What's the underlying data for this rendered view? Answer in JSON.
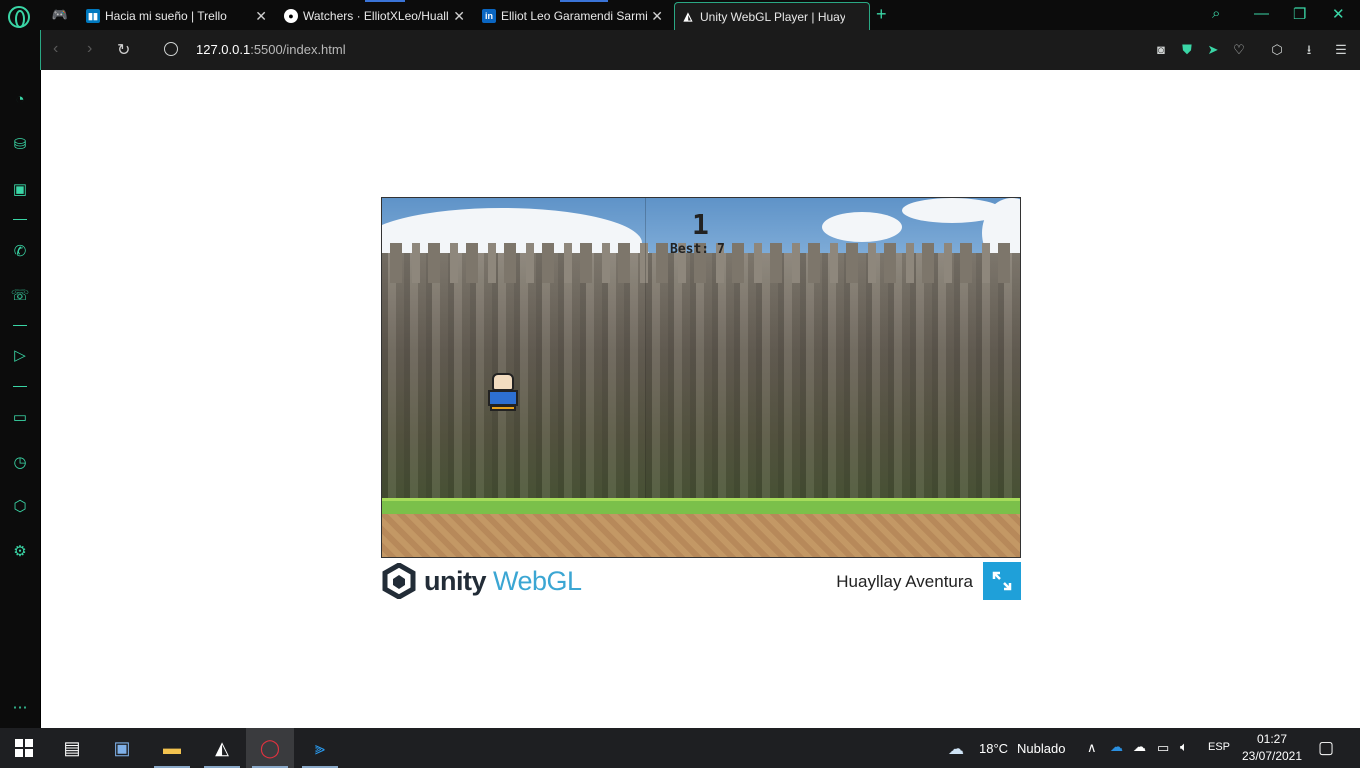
{
  "browser": {
    "tabs": [
      {
        "title": "Hacia mi sueño | Trello",
        "favicon": "trello-icon",
        "color": "#0079bf"
      },
      {
        "title": "Watchers · ElliotXLeo/Huall",
        "favicon": "github-icon",
        "color": "#ffffff"
      },
      {
        "title": "Elliot Leo Garamendi Sarmi",
        "favicon": "linkedin-icon",
        "color": "#0a66c2"
      },
      {
        "title": "Unity WebGL Player | Huayl",
        "favicon": "unity-icon",
        "color": "#ffffff"
      }
    ],
    "url_host": "127.0.0.1",
    "url_rest": ":5500/index.html"
  },
  "sidebar": {
    "icons": [
      "speed-dial-icon",
      "workspace-icon",
      "twitch-icon",
      "messenger-icon",
      "whatsapp-icon",
      "player-icon",
      "snapshot-icon",
      "history-icon",
      "extensions-icon",
      "settings-icon",
      "more-icon"
    ],
    "accent": "#3ad6a6"
  },
  "game": {
    "score": "1",
    "best": "Best: 7"
  },
  "unity_footer": {
    "unity_text": "unity",
    "webgl_text": "WebGL",
    "title": "Huayllay Aventura"
  },
  "taskbar": {
    "weather_temp": "18°C",
    "weather_desc": "Nublado",
    "language": "ESP",
    "time": "01:27",
    "date": "23/07/2021"
  }
}
